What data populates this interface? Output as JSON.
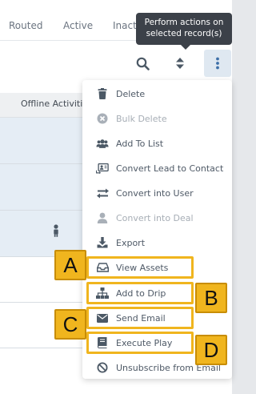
{
  "tabs": {
    "routed": "Routed",
    "active": "Active",
    "inactive": "Inact"
  },
  "tooltip": {
    "line1": "Perform actions on",
    "line2": "selected record(s)"
  },
  "toolbar": {
    "search_icon": "search-icon",
    "sort_icon": "sort-icon",
    "more_icon": "more-vertical-icon"
  },
  "table": {
    "column_header": "Offline Activiti"
  },
  "menu": {
    "items": [
      {
        "label": "Delete",
        "icon": "trash-icon",
        "disabled": false
      },
      {
        "label": "Bulk Delete",
        "icon": "x-circle-icon",
        "disabled": true
      },
      {
        "label": "Add To List",
        "icon": "users-icon",
        "disabled": false
      },
      {
        "label": "Convert Lead to Contact",
        "icon": "contact-card-icon",
        "disabled": false
      },
      {
        "label": "Convert into User",
        "icon": "swap-arrows-icon",
        "disabled": false
      },
      {
        "label": "Convert into Deal",
        "icon": "person-icon",
        "disabled": true
      },
      {
        "label": "Export",
        "icon": "download-icon",
        "disabled": false
      },
      {
        "label": "View Assets",
        "icon": "inbox-icon",
        "disabled": false
      },
      {
        "label": "Add to Drip",
        "icon": "sitemap-icon",
        "disabled": false
      },
      {
        "label": "Send Email",
        "icon": "envelope-icon",
        "disabled": false
      },
      {
        "label": "Execute Play",
        "icon": "book-icon",
        "disabled": false
      },
      {
        "label": "Unsubscribe from Email",
        "icon": "ban-icon",
        "disabled": false
      }
    ]
  },
  "annotations": {
    "a": "A",
    "b": "B",
    "c": "C",
    "d": "D"
  },
  "colors": {
    "highlight": "#f0b51e",
    "selected_row": "#e5edf5",
    "tooltip_bg": "#3c4149",
    "icon": "#4c5966"
  }
}
